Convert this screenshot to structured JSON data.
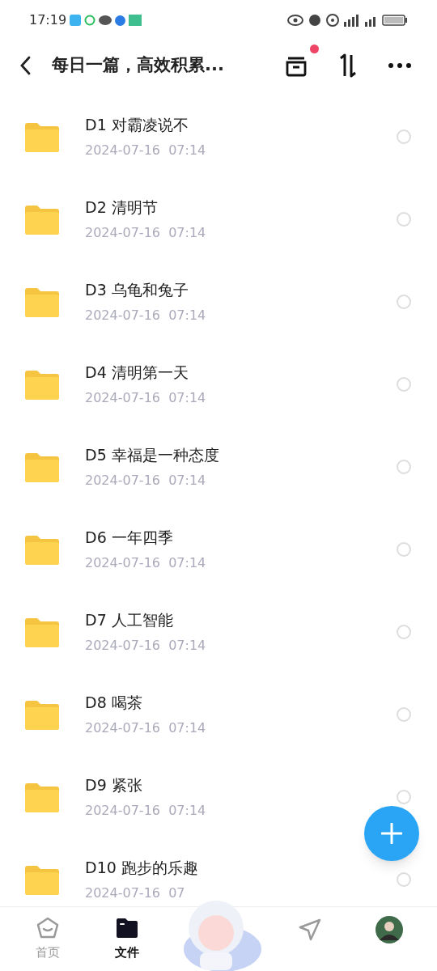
{
  "status_bar": {
    "time": "17:19"
  },
  "header": {
    "title": "每日一篇，高效积累...",
    "archive_badge": true
  },
  "files": [
    {
      "name": "D1 对霸凌说不",
      "date": "2024-07-16  07:14",
      "selected": false
    },
    {
      "name": "D2 清明节",
      "date": "2024-07-16  07:14",
      "selected": false
    },
    {
      "name": "D3 乌龟和兔子",
      "date": "2024-07-16  07:14",
      "selected": false
    },
    {
      "name": "D4 清明第一天",
      "date": "2024-07-16  07:14",
      "selected": false
    },
    {
      "name": "D5 幸福是一种态度",
      "date": "2024-07-16  07:14",
      "selected": false
    },
    {
      "name": "D6 一年四季",
      "date": "2024-07-16  07:14",
      "selected": false
    },
    {
      "name": "D7 人工智能",
      "date": "2024-07-16  07:14",
      "selected": false
    },
    {
      "name": "D8 喝茶",
      "date": "2024-07-16  07:14",
      "selected": false
    },
    {
      "name": "D9 紧张",
      "date": "2024-07-16  07:14",
      "selected": false
    },
    {
      "name": "D10 跑步的乐趣",
      "date": "2024-07-16  07",
      "selected": false
    }
  ],
  "bottom_nav": [
    {
      "kind": "home",
      "label": "首页",
      "selected": false
    },
    {
      "kind": "files",
      "label": "文件",
      "selected": true
    },
    {
      "kind": "mascot"
    },
    {
      "kind": "share"
    },
    {
      "kind": "profile"
    }
  ]
}
